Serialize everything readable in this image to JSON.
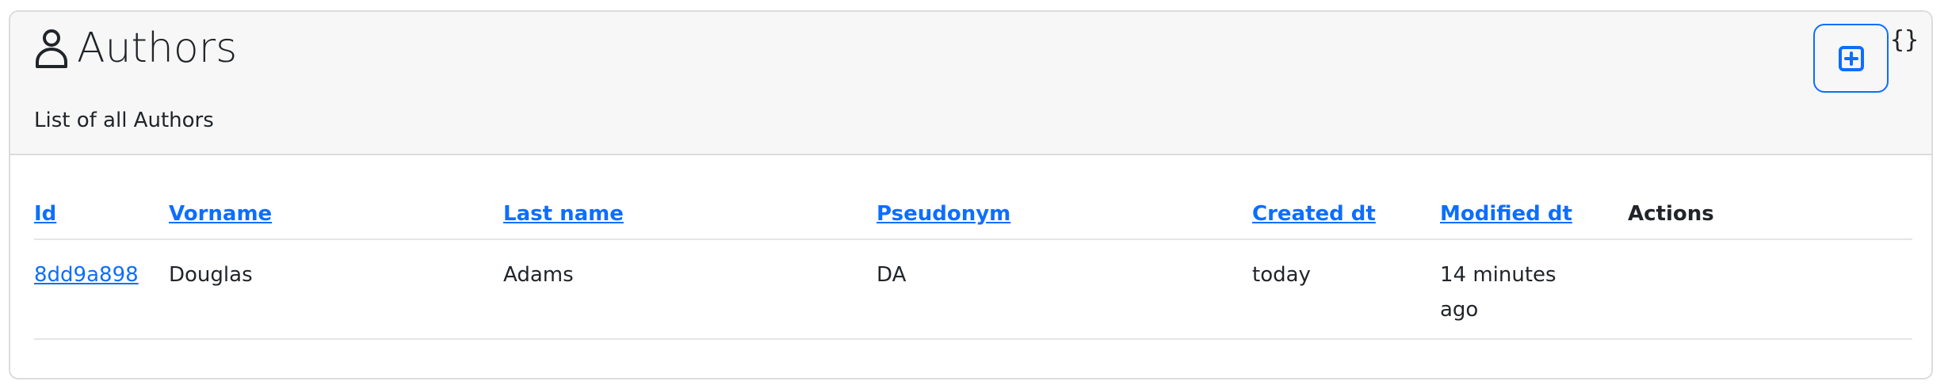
{
  "header": {
    "title": "Authors",
    "subtitle": "List of all Authors",
    "add_icon": "plus-square-icon",
    "json_label": "{}"
  },
  "table": {
    "columns": [
      "Id",
      "Vorname",
      "Last name",
      "Pseudonym",
      "Created dt",
      "Modified dt",
      "Actions"
    ],
    "rows": [
      {
        "id": "8dd9a898",
        "vorname": "Douglas",
        "last_name": "Adams",
        "pseudonym": "DA",
        "created": "today",
        "modified": "14 minutes ago",
        "actions": ""
      }
    ]
  },
  "colors": {
    "accent": "#0d6efd"
  }
}
